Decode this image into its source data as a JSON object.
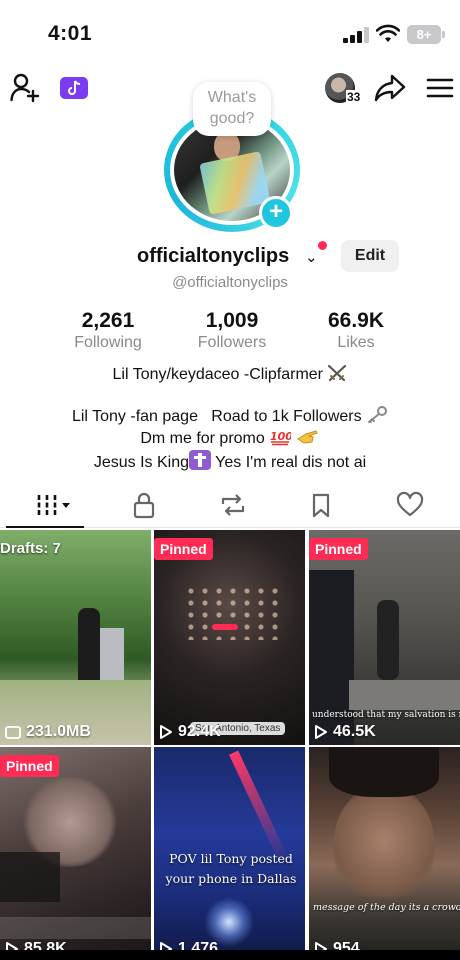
{
  "status": {
    "time": "4:01",
    "battery": "8+"
  },
  "profile": {
    "bubble_note": "What's good?",
    "username": "officialtonyclips",
    "handle": "@officialtonyclips",
    "edit_label": "Edit",
    "notification_count": "33"
  },
  "stats": [
    {
      "value": "2,261",
      "label": "Following"
    },
    {
      "value": "1,009",
      "label": "Followers"
    },
    {
      "value": "66.9K",
      "label": "Likes"
    }
  ],
  "bio": {
    "line1": "Lil Tony/keydaceo -Clipfarmer",
    "line2": "Lil Tony -fan page   Road to 1k Followers",
    "line3": "Dm me for promo",
    "line4a": "Jesus Is King",
    "line4b": " Yes I'm real dis not ai"
  },
  "tabs": [
    {
      "name": "videos",
      "icon": "grid-icon"
    },
    {
      "name": "private",
      "icon": "lock-icon"
    },
    {
      "name": "reposts",
      "icon": "repost-icon"
    },
    {
      "name": "saved",
      "icon": "bookmark-icon"
    },
    {
      "name": "liked",
      "icon": "heart-icon"
    }
  ],
  "videos": [
    {
      "badge": "Drafts: 7",
      "stat": "231.0MB",
      "stat_icon": "folder-icon"
    },
    {
      "badge": "Pinned",
      "stat": "92.4K",
      "stat_icon": "play-icon",
      "location_tag": "San Antonio, Texas"
    },
    {
      "badge": "Pinned",
      "stat": "46.5K",
      "stat_icon": "play-icon",
      "caption": "understood that my salvation is m"
    },
    {
      "badge": "Pinned",
      "stat": "85.8K",
      "stat_icon": "play-icon"
    },
    {
      "badge": "",
      "stat": "1,476",
      "stat_icon": "play-icon",
      "caption": "POV lil Tony posted your phone in Dallas"
    },
    {
      "badge": "",
      "stat": "954",
      "stat_icon": "play-icon",
      "caption": "message of the day its a crowd fa"
    }
  ],
  "colors": {
    "accent": "#fe2c55",
    "ring": "#25d0e6",
    "badge_purple": "#7b3cf0"
  }
}
